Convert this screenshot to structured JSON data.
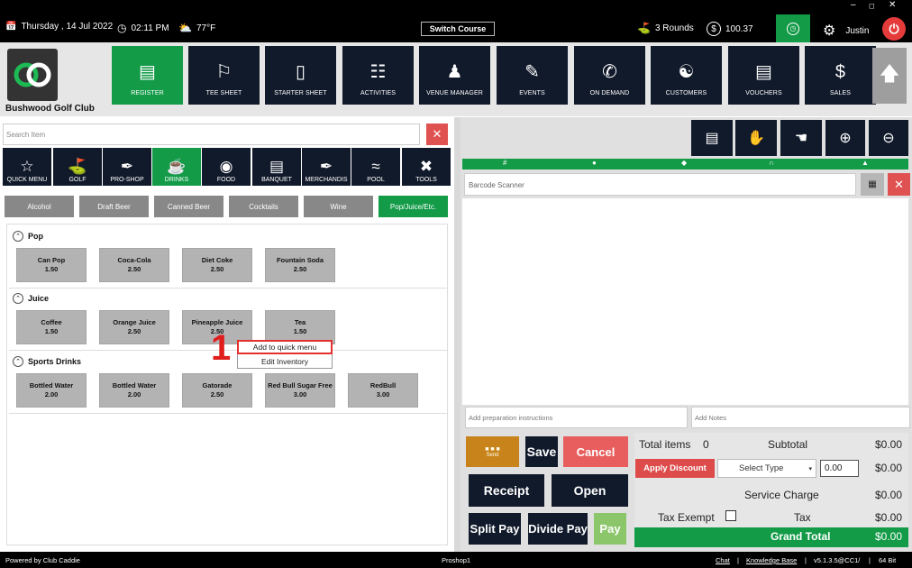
{
  "topbar": {
    "date": "Thursday ,  14 Jul 2022",
    "time": "02:11 PM",
    "weather": "77°F",
    "switch_course": "Switch Course",
    "rounds": "3 Rounds",
    "balance": "100.37",
    "user": "Justin",
    "icons": [
      "calendar-icon",
      "clock-icon",
      "cloud-sun-icon",
      "golf-icon",
      "dollar-icon",
      "clock-icon",
      "gear-icon",
      "power-icon"
    ]
  },
  "header": {
    "club_name": "Bushwood Golf Club",
    "nav": [
      {
        "label": "REGISTER",
        "icon": "barcode-scanner-icon"
      },
      {
        "label": "TEE SHEET",
        "icon": "flag-sheet-icon"
      },
      {
        "label": "STARTER SHEET",
        "icon": "tablet-icon"
      },
      {
        "label": "ACTIVITIES",
        "icon": "calendar-list-icon"
      },
      {
        "label": "VENUE MANAGER",
        "icon": "people-icon"
      },
      {
        "label": "EVENTS",
        "icon": "calendar-edit-icon"
      },
      {
        "label": "ON DEMAND",
        "icon": "mobile-icon"
      },
      {
        "label": "CUSTOMERS",
        "icon": "customers-icon"
      },
      {
        "label": "VOUCHERS",
        "icon": "voucher-icon"
      },
      {
        "label": "SALES",
        "icon": "money-icon"
      }
    ]
  },
  "search": {
    "placeholder": "Search Item"
  },
  "categories": [
    {
      "label": "QUICK MENU",
      "icon": "star-icon"
    },
    {
      "label": "GOLF",
      "icon": "golf-icon"
    },
    {
      "label": "PRO-SHOP",
      "icon": "tag-icon"
    },
    {
      "label": "DRINKS",
      "icon": "beer-mug-icon"
    },
    {
      "label": "FOOD",
      "icon": "burger-icon"
    },
    {
      "label": "BANQUET",
      "icon": "receipt-icon"
    },
    {
      "label": "MERCHANDIS",
      "icon": "tag-icon"
    },
    {
      "label": "POOL",
      "icon": "pool-icon"
    },
    {
      "label": "TOOLS",
      "icon": "tools-icon"
    }
  ],
  "subcategories": [
    "Alcohol",
    "Draft Beer",
    "Canned Beer",
    "Cocktails",
    "Wine",
    "Pop/Juice/Etc."
  ],
  "sections": [
    {
      "title": "Pop",
      "items": [
        {
          "name": "Can Pop",
          "price": "1.50"
        },
        {
          "name": "Coca-Cola",
          "price": "2.50"
        },
        {
          "name": "Diet Coke",
          "price": "2.50"
        },
        {
          "name": "Fountain Soda",
          "price": "2.50"
        }
      ]
    },
    {
      "title": "Juice",
      "items": [
        {
          "name": "Coffee",
          "price": "1.50"
        },
        {
          "name": "Orange Juice",
          "price": "2.50"
        },
        {
          "name": "Pineapple Juice",
          "price": "2.50"
        },
        {
          "name": "Tea",
          "price": "1.50"
        }
      ]
    },
    {
      "title": "Sports Drinks",
      "items": [
        {
          "name": "Bottled Water",
          "price": "2.00"
        },
        {
          "name": "Bottled Water",
          "price": "2.00"
        },
        {
          "name": "Gatorade",
          "price": "2.50"
        },
        {
          "name": "Red Bull Sugar Free",
          "price": "3.00"
        },
        {
          "name": "RedBull",
          "price": "3.00"
        }
      ]
    }
  ],
  "context_menu": {
    "add": "Add to quick menu",
    "edit": "Edit Inventory"
  },
  "step_marker": "1",
  "right": {
    "tool_icons": [
      "cart-icon",
      "hand-card-icon",
      "hand-pay-icon",
      "plus-circle-icon",
      "minus-circle-icon"
    ],
    "column_icons": [
      "hash-icon",
      "user-icon",
      "tag-icon",
      "cart-icon",
      "person-icon"
    ],
    "barcode_placeholder": "Barcode Scanner",
    "prep_placeholder": "Add preparation instructions",
    "notes_placeholder": "Add Notes",
    "send_label": "Send",
    "save": "Save",
    "cancel": "Cancel",
    "receipt": "Receipt",
    "open": "Open",
    "split_pay": "Split Pay",
    "divide_pay": "Divide Pay",
    "pay": "Pay"
  },
  "totals": {
    "total_items_label": "Total items",
    "total_items": "0",
    "subtotal_label": "Subtotal",
    "subtotal": "$0.00",
    "apply_discount": "Apply Discount",
    "select_type": "Select Type",
    "discount_value": "0.00",
    "discount": "$0.00",
    "service_charge_label": "Service Charge",
    "service_charge": "$0.00",
    "tax_exempt_label": "Tax Exempt",
    "tax_label": "Tax",
    "tax": "$0.00",
    "grand_total_label": "Grand Total",
    "grand_total": "$0.00"
  },
  "footer": {
    "powered": "Powered by Club Caddie",
    "station": "Proshop1",
    "chat": "Chat",
    "kb": "Knowledge Base",
    "version": "v5.1.3.5@CC1/",
    "bits": "64 Bit"
  },
  "colors": {
    "green": "#139b48",
    "navy": "#111a2b",
    "red": "#e05252",
    "orange": "#c8831a"
  }
}
